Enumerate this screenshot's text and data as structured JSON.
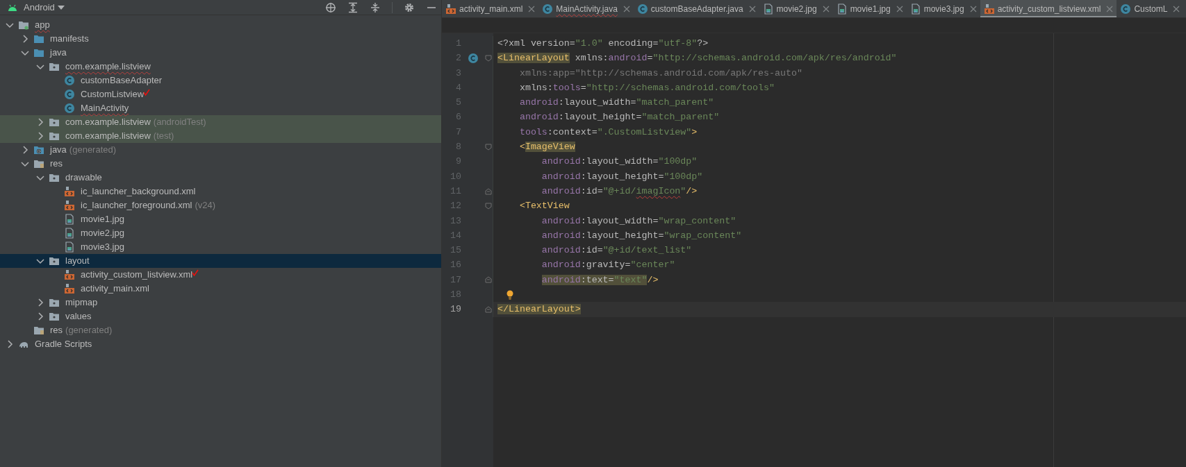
{
  "project_panel": {
    "title": "Android",
    "tree": [
      {
        "label": "app",
        "kind": "module",
        "expanded": true,
        "selected": false,
        "misspelled": true,
        "children": [
          {
            "label": "manifests",
            "kind": "folder",
            "expanded": false,
            "selected": false
          },
          {
            "label": "java",
            "kind": "folder",
            "expanded": true,
            "selected": false,
            "children": [
              {
                "label": "com.example.listview",
                "kind": "package",
                "expanded": true,
                "selected": false,
                "misspelled": true,
                "children": [
                  {
                    "label": "customBaseAdapter",
                    "kind": "class",
                    "selected": false
                  },
                  {
                    "label": "CustomListview",
                    "kind": "class",
                    "selected": false,
                    "annotated": true
                  },
                  {
                    "label": "MainActivity",
                    "kind": "class",
                    "selected": false,
                    "misspelled": true
                  }
                ]
              },
              {
                "label": "com.example.listview",
                "suffix": "(androidTest)",
                "kind": "package",
                "expanded": false,
                "selected": false,
                "tinted": true
              },
              {
                "label": "com.example.listview",
                "suffix": "(test)",
                "kind": "package",
                "expanded": false,
                "selected": false,
                "tinted": true
              }
            ]
          },
          {
            "label": "java",
            "suffix": "(generated)",
            "kind": "generated",
            "expanded": false,
            "selected": false
          },
          {
            "label": "res",
            "kind": "res",
            "expanded": true,
            "selected": false,
            "children": [
              {
                "label": "drawable",
                "kind": "package",
                "expanded": true,
                "selected": false,
                "children": [
                  {
                    "label": "ic_launcher_background.xml",
                    "kind": "xml",
                    "selected": false
                  },
                  {
                    "label": "ic_launcher_foreground.xml",
                    "suffix": "(v24)",
                    "kind": "xml",
                    "selected": false
                  },
                  {
                    "label": "movie1.jpg",
                    "kind": "image",
                    "selected": false
                  },
                  {
                    "label": "movie2.jpg",
                    "kind": "image",
                    "selected": false
                  },
                  {
                    "label": "movie3.jpg",
                    "kind": "image",
                    "selected": false
                  }
                ]
              },
              {
                "label": "layout",
                "kind": "package",
                "expanded": true,
                "selected": true,
                "children": [
                  {
                    "label": "activity_custom_listview.xml",
                    "kind": "xml",
                    "selected": false,
                    "annotated": true
                  },
                  {
                    "label": "activity_main.xml",
                    "kind": "xml",
                    "selected": false
                  }
                ]
              },
              {
                "label": "mipmap",
                "kind": "package",
                "expanded": false,
                "selected": false
              },
              {
                "label": "values",
                "kind": "package",
                "expanded": false,
                "selected": false
              }
            ]
          },
          {
            "label": "res",
            "suffix": "(generated)",
            "kind": "res",
            "selected": false
          }
        ]
      },
      {
        "label": "Gradle Scripts",
        "kind": "gradle",
        "expanded": false,
        "selected": false
      }
    ]
  },
  "editor": {
    "tabs": [
      {
        "label": "activity_main.xml",
        "kind": "xml",
        "selected": false
      },
      {
        "label": "MainActivity.java",
        "kind": "class",
        "selected": false,
        "misspelled": true
      },
      {
        "label": "customBaseAdapter.java",
        "kind": "class",
        "selected": false
      },
      {
        "label": "movie2.jpg",
        "kind": "image",
        "selected": false
      },
      {
        "label": "movie1.jpg",
        "kind": "image",
        "selected": false
      },
      {
        "label": "movie3.jpg",
        "kind": "image",
        "selected": false
      },
      {
        "label": "activity_custom_listview.xml",
        "kind": "xml",
        "selected": true
      },
      {
        "label": "CustomL",
        "kind": "class",
        "selected": false
      }
    ],
    "lines": [
      {
        "number": "1",
        "segments": [
          {
            "kind": "name",
            "text": "<?xml version="
          },
          {
            "kind": "value",
            "text": "\"1.0\""
          },
          {
            "kind": "name",
            "text": " encoding="
          },
          {
            "kind": "value",
            "text": "\"utf-8\""
          },
          {
            "kind": "name",
            "text": "?>"
          }
        ]
      },
      {
        "number": "2",
        "gutter_icon": true,
        "fold_start": true,
        "segments": [
          {
            "kind": "tag",
            "text": "<LinearLayout",
            "highlighted": true
          },
          {
            "kind": "name",
            "text": " xmlns:"
          },
          {
            "kind": "ns",
            "text": "android"
          },
          {
            "kind": "name",
            "text": "="
          },
          {
            "kind": "value",
            "text": "\"http://schemas.android.com/apk/res/android\""
          }
        ]
      },
      {
        "number": "3",
        "segments": [
          {
            "kind": "unused",
            "text": "    xmlns:app=\"http://schemas.android.com/apk/res-auto\""
          }
        ]
      },
      {
        "number": "4",
        "segments": [
          {
            "kind": "name",
            "text": "    xmlns:"
          },
          {
            "kind": "ns",
            "text": "tools"
          },
          {
            "kind": "name",
            "text": "="
          },
          {
            "kind": "value",
            "text": "\"http://schemas.android.com/tools\""
          }
        ]
      },
      {
        "number": "5",
        "segments": [
          {
            "kind": "ns",
            "text": "    android"
          },
          {
            "kind": "name",
            "text": ":layout_width="
          },
          {
            "kind": "value",
            "text": "\"match_parent\""
          }
        ]
      },
      {
        "number": "6",
        "segments": [
          {
            "kind": "ns",
            "text": "    android"
          },
          {
            "kind": "name",
            "text": ":layout_height="
          },
          {
            "kind": "value",
            "text": "\"match_parent\""
          }
        ]
      },
      {
        "number": "7",
        "segments": [
          {
            "kind": "ns",
            "text": "    tools"
          },
          {
            "kind": "name",
            "text": ":context="
          },
          {
            "kind": "value",
            "text": "\".CustomListview\""
          },
          {
            "kind": "tag",
            "text": ">"
          }
        ]
      },
      {
        "number": "8",
        "fold_start": true,
        "segments": [
          {
            "kind": "tag",
            "text": "    <"
          },
          {
            "kind": "tag",
            "text": "ImageView",
            "highlighted": true
          }
        ]
      },
      {
        "number": "9",
        "segments": [
          {
            "kind": "ns",
            "text": "        android"
          },
          {
            "kind": "name",
            "text": ":layout_width="
          },
          {
            "kind": "value",
            "text": "\"100dp\""
          }
        ]
      },
      {
        "number": "10",
        "segments": [
          {
            "kind": "ns",
            "text": "        android"
          },
          {
            "kind": "name",
            "text": ":layout_height="
          },
          {
            "kind": "value",
            "text": "\"100dp\""
          }
        ]
      },
      {
        "number": "11",
        "fold_end": true,
        "segments": [
          {
            "kind": "ns",
            "text": "        android"
          },
          {
            "kind": "name",
            "text": ":id="
          },
          {
            "kind": "value",
            "text": "\"@+id/"
          },
          {
            "kind": "value",
            "text": "imagIcon",
            "misspelled": true
          },
          {
            "kind": "value",
            "text": "\""
          },
          {
            "kind": "tag",
            "text": "/>"
          }
        ]
      },
      {
        "number": "12",
        "fold_start": true,
        "segments": [
          {
            "kind": "tag",
            "text": "    <TextView"
          }
        ]
      },
      {
        "number": "13",
        "segments": [
          {
            "kind": "ns",
            "text": "        android"
          },
          {
            "kind": "name",
            "text": ":layout_width="
          },
          {
            "kind": "value",
            "text": "\"wrap_content\""
          }
        ]
      },
      {
        "number": "14",
        "segments": [
          {
            "kind": "ns",
            "text": "        android"
          },
          {
            "kind": "name",
            "text": ":layout_height="
          },
          {
            "kind": "value",
            "text": "\"wrap_content\""
          }
        ]
      },
      {
        "number": "15",
        "segments": [
          {
            "kind": "ns",
            "text": "        android"
          },
          {
            "kind": "name",
            "text": ":id="
          },
          {
            "kind": "value",
            "text": "\"@+id/text_list\""
          }
        ]
      },
      {
        "number": "16",
        "segments": [
          {
            "kind": "ns",
            "text": "        android"
          },
          {
            "kind": "name",
            "text": ":gravity="
          },
          {
            "kind": "value",
            "text": "\"center\""
          }
        ]
      },
      {
        "number": "17",
        "fold_end": true,
        "segments": [
          {
            "kind": "ns",
            "text": "        android",
            "highlighted": true
          },
          {
            "kind": "name",
            "text": ":text=",
            "highlighted": true
          },
          {
            "kind": "value",
            "text": "\"text\"",
            "highlighted": true
          },
          {
            "kind": "tag",
            "text": "/>"
          }
        ]
      },
      {
        "number": "18",
        "intention_bulb": true
      },
      {
        "number": "19",
        "fold_end": true,
        "current": true,
        "segments": [
          {
            "kind": "tag",
            "text": "</LinearLayout>",
            "highlighted": true
          }
        ]
      }
    ]
  }
}
